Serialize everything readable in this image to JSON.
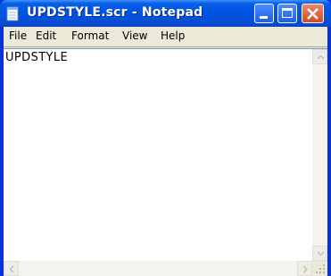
{
  "window": {
    "title": "UPDSTYLE.scr - Notepad",
    "icon": "notepad-icon",
    "controls": [
      "minimize-icon",
      "maximize-icon",
      "close-icon"
    ]
  },
  "menu": {
    "file": "File",
    "edit": "Edit",
    "format": "Format",
    "view": "View",
    "help": "Help"
  },
  "editor": {
    "content": "UPDSTYLE"
  },
  "colors": {
    "titlebar": "#0055e5",
    "close_button": "#d24a24",
    "menubar": "#ece9d8"
  }
}
